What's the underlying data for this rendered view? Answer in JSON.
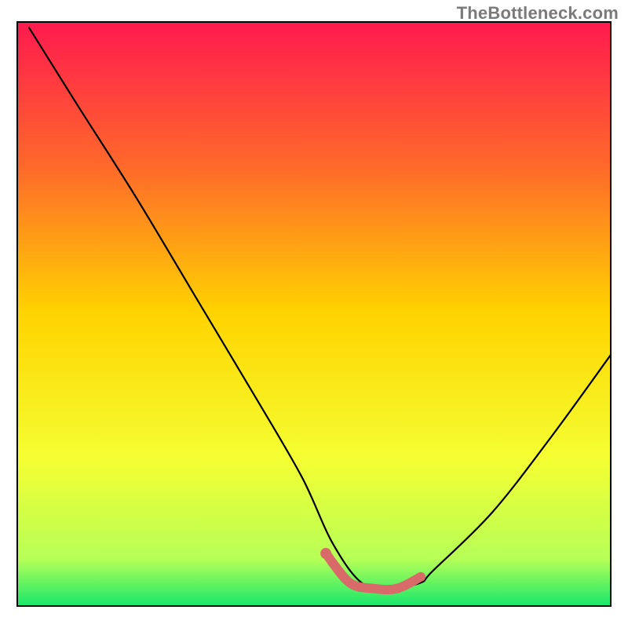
{
  "watermark": "TheBottleneck.com",
  "chart_data": {
    "type": "line",
    "title": "",
    "xlabel": "",
    "ylabel": "",
    "xlim": [
      0,
      100
    ],
    "ylim": [
      0,
      100
    ],
    "grid": false,
    "legend": false,
    "series": [
      {
        "name": "bottleneck-curve",
        "x": [
          2,
          10,
          20,
          30,
          40,
          48,
          53,
          58,
          63,
          68,
          70,
          80,
          90,
          100
        ],
        "values": [
          99,
          86,
          70,
          53,
          36,
          22,
          11,
          4,
          3,
          4,
          6,
          16,
          29,
          43
        ]
      }
    ],
    "highlight": {
      "name": "optimal-range",
      "x": [
        52,
        56,
        60,
        64,
        68
      ],
      "values": [
        9,
        4,
        3,
        3,
        5
      ]
    },
    "background": {
      "gradient_stops": [
        {
          "offset": 0.0,
          "color": "#ff1a4f"
        },
        {
          "offset": 0.25,
          "color": "#ff6a2a"
        },
        {
          "offset": 0.5,
          "color": "#ffd400"
        },
        {
          "offset": 0.75,
          "color": "#f4ff33"
        },
        {
          "offset": 0.92,
          "color": "#b6ff57"
        },
        {
          "offset": 1.0,
          "color": "#17e86b"
        }
      ]
    }
  }
}
